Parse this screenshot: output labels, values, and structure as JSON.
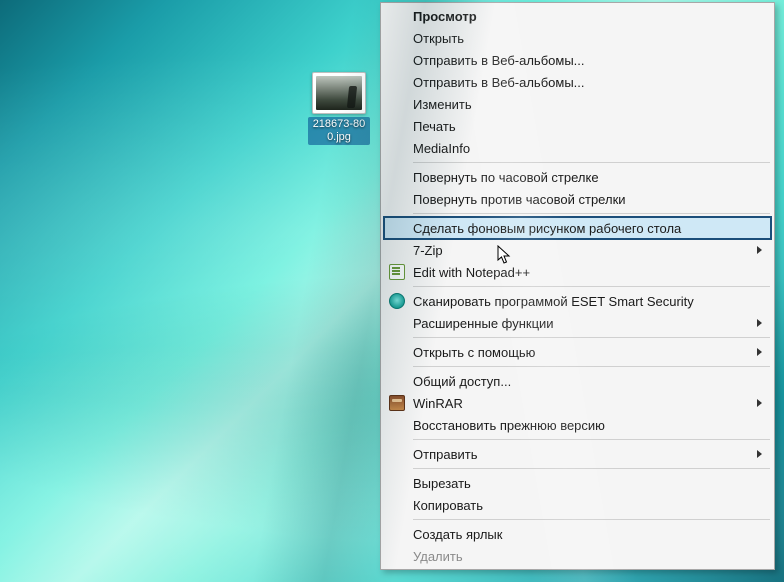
{
  "desktop": {
    "icon_label": "218673-800.jpg"
  },
  "context_menu": {
    "items": [
      {
        "label": "Просмотр",
        "type": "bold"
      },
      {
        "label": "Открыть",
        "type": "normal"
      },
      {
        "label": "Отправить в Веб-альбомы...",
        "type": "normal"
      },
      {
        "label": "Отправить в Веб-альбомы...",
        "type": "normal"
      },
      {
        "label": "Изменить",
        "type": "normal"
      },
      {
        "label": "Печать",
        "type": "normal"
      },
      {
        "label": "MediaInfo",
        "type": "normal"
      },
      {
        "type": "sep"
      },
      {
        "label": "Повернуть по часовой стрелке",
        "type": "normal"
      },
      {
        "label": "Повернуть против часовой стрелки",
        "type": "normal"
      },
      {
        "type": "sep"
      },
      {
        "label": "Сделать фоновым рисунком рабочего стола",
        "type": "highlight"
      },
      {
        "label": "7-Zip",
        "type": "submenu"
      },
      {
        "label": "Edit with Notepad++",
        "type": "normal",
        "icon": "notepad"
      },
      {
        "type": "sep"
      },
      {
        "label": "Сканировать программой ESET Smart Security",
        "type": "normal",
        "icon": "eset"
      },
      {
        "label": "Расширенные функции",
        "type": "submenu"
      },
      {
        "type": "sep"
      },
      {
        "label": "Открыть с помощью",
        "type": "submenu"
      },
      {
        "type": "sep"
      },
      {
        "label": "Общий доступ...",
        "type": "normal"
      },
      {
        "label": "WinRAR",
        "type": "submenu",
        "icon": "winrar"
      },
      {
        "label": "Восстановить прежнюю версию",
        "type": "normal"
      },
      {
        "type": "sep"
      },
      {
        "label": "Отправить",
        "type": "submenu"
      },
      {
        "type": "sep"
      },
      {
        "label": "Вырезать",
        "type": "normal"
      },
      {
        "label": "Копировать",
        "type": "normal"
      },
      {
        "type": "sep"
      },
      {
        "label": "Создать ярлык",
        "type": "normal"
      },
      {
        "label": "Удалить",
        "type": "disabled"
      }
    ]
  }
}
